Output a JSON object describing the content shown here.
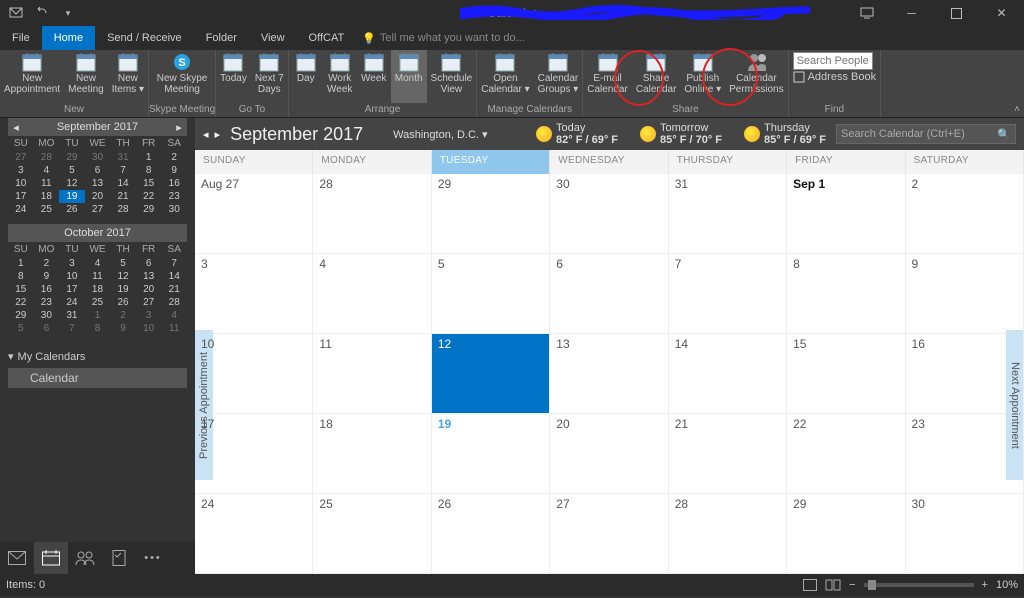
{
  "title_bar": {
    "app_title": "Calendar"
  },
  "ribbon": {
    "tabs": [
      "File",
      "Home",
      "Send / Receive",
      "Folder",
      "View",
      "OffCAT"
    ],
    "active_tab": "Home",
    "tellme": "Tell me what you want to do...",
    "groups": {
      "new": {
        "label": "New",
        "buttons": [
          {
            "l": "New\nAppointment"
          },
          {
            "l": "New\nMeeting"
          },
          {
            "l": "New\nItems ▾"
          }
        ]
      },
      "skype": {
        "label": "Skype Meeting",
        "buttons": [
          {
            "l": "New Skype\nMeeting"
          }
        ]
      },
      "goto": {
        "label": "Go To",
        "buttons": [
          {
            "l": "Today"
          },
          {
            "l": "Next 7\nDays"
          }
        ]
      },
      "arrange": {
        "label": "Arrange",
        "buttons": [
          {
            "l": "Day"
          },
          {
            "l": "Work\nWeek"
          },
          {
            "l": "Week"
          },
          {
            "l": "Month"
          },
          {
            "l": "Schedule\nView"
          }
        ],
        "selected": 3
      },
      "manage": {
        "label": "Manage Calendars",
        "buttons": [
          {
            "l": "Open\nCalendar ▾"
          },
          {
            "l": "Calendar\nGroups ▾"
          }
        ]
      },
      "share": {
        "label": "Share",
        "buttons": [
          {
            "l": "E-mail\nCalendar"
          },
          {
            "l": "Share\nCalendar"
          },
          {
            "l": "Publish\nOnline ▾"
          },
          {
            "l": "Calendar\nPermissions"
          }
        ]
      },
      "find": {
        "label": "Find",
        "search_placeholder": "Search People",
        "addr": "Address Book"
      }
    }
  },
  "sidebar": {
    "cal1": {
      "title": "September 2017",
      "dow": [
        "SU",
        "MO",
        "TU",
        "WE",
        "TH",
        "FR",
        "SA"
      ],
      "days": [
        {
          "n": 27,
          "dim": 1
        },
        {
          "n": 28,
          "dim": 1
        },
        {
          "n": 29,
          "dim": 1
        },
        {
          "n": 30,
          "dim": 1
        },
        {
          "n": 31,
          "dim": 1
        },
        {
          "n": 1
        },
        {
          "n": 2
        },
        {
          "n": 3
        },
        {
          "n": 4
        },
        {
          "n": 5
        },
        {
          "n": 6
        },
        {
          "n": 7
        },
        {
          "n": 8
        },
        {
          "n": 9
        },
        {
          "n": 10
        },
        {
          "n": 11
        },
        {
          "n": 12
        },
        {
          "n": 13
        },
        {
          "n": 14
        },
        {
          "n": 15
        },
        {
          "n": 16
        },
        {
          "n": 17
        },
        {
          "n": 18
        },
        {
          "n": 19,
          "today": 1
        },
        {
          "n": 20
        },
        {
          "n": 21
        },
        {
          "n": 22
        },
        {
          "n": 23
        },
        {
          "n": 24
        },
        {
          "n": 25
        },
        {
          "n": 26
        },
        {
          "n": 27
        },
        {
          "n": 28
        },
        {
          "n": 29
        },
        {
          "n": 30
        }
      ]
    },
    "cal2": {
      "title": "October 2017",
      "dow": [
        "SU",
        "MO",
        "TU",
        "WE",
        "TH",
        "FR",
        "SA"
      ],
      "days": [
        {
          "n": 1
        },
        {
          "n": 2
        },
        {
          "n": 3
        },
        {
          "n": 4
        },
        {
          "n": 5
        },
        {
          "n": 6
        },
        {
          "n": 7
        },
        {
          "n": 8
        },
        {
          "n": 9
        },
        {
          "n": 10
        },
        {
          "n": 11
        },
        {
          "n": 12
        },
        {
          "n": 13
        },
        {
          "n": 14
        },
        {
          "n": 15
        },
        {
          "n": 16
        },
        {
          "n": 17
        },
        {
          "n": 18
        },
        {
          "n": 19
        },
        {
          "n": 20
        },
        {
          "n": 21
        },
        {
          "n": 22
        },
        {
          "n": 23
        },
        {
          "n": 24
        },
        {
          "n": 25
        },
        {
          "n": 26
        },
        {
          "n": 27
        },
        {
          "n": 28
        },
        {
          "n": 29
        },
        {
          "n": 30
        },
        {
          "n": 31
        },
        {
          "n": 1,
          "dim": 1
        },
        {
          "n": 2,
          "dim": 1
        },
        {
          "n": 3,
          "dim": 1
        },
        {
          "n": 4,
          "dim": 1
        },
        {
          "n": 5,
          "dim": 1
        },
        {
          "n": 6,
          "dim": 1
        },
        {
          "n": 7,
          "dim": 1
        },
        {
          "n": 8,
          "dim": 1
        },
        {
          "n": 9,
          "dim": 1
        },
        {
          "n": 10,
          "dim": 1
        },
        {
          "n": 11,
          "dim": 1
        }
      ]
    },
    "tree": {
      "header": "My Calendars",
      "item": "Calendar"
    }
  },
  "calendar": {
    "month_title": "September 2017",
    "location": "Washington,  D.C. ▾",
    "weather": [
      {
        "label": "Today",
        "temp": "82° F / 69° F"
      },
      {
        "label": "Tomorrow",
        "temp": "85° F / 70° F"
      },
      {
        "label": "Thursday",
        "temp": "85° F / 69° F"
      }
    ],
    "search_placeholder": "Search Calendar (Ctrl+E)",
    "day_headers": [
      "SUNDAY",
      "MONDAY",
      "TUESDAY",
      "WEDNESDAY",
      "THURSDAY",
      "FRIDAY",
      "SATURDAY"
    ],
    "rows": [
      [
        {
          "d": "Aug 27"
        },
        {
          "d": "28"
        },
        {
          "d": "29"
        },
        {
          "d": "30"
        },
        {
          "d": "31"
        },
        {
          "d": "Sep 1",
          "bold": 1
        },
        {
          "d": "2"
        }
      ],
      [
        {
          "d": "3"
        },
        {
          "d": "4"
        },
        {
          "d": "5"
        },
        {
          "d": "6"
        },
        {
          "d": "7"
        },
        {
          "d": "8"
        },
        {
          "d": "9"
        }
      ],
      [
        {
          "d": "10"
        },
        {
          "d": "11"
        },
        {
          "d": "12",
          "sel": 1
        },
        {
          "d": "13"
        },
        {
          "d": "14"
        },
        {
          "d": "15"
        },
        {
          "d": "16"
        }
      ],
      [
        {
          "d": "17"
        },
        {
          "d": "18"
        },
        {
          "d": "19",
          "today": 1
        },
        {
          "d": "20"
        },
        {
          "d": "21"
        },
        {
          "d": "22"
        },
        {
          "d": "23"
        }
      ],
      [
        {
          "d": "24"
        },
        {
          "d": "25"
        },
        {
          "d": "26"
        },
        {
          "d": "27"
        },
        {
          "d": "28"
        },
        {
          "d": "29"
        },
        {
          "d": "30"
        }
      ]
    ],
    "prev_tab": "Previous Appointment",
    "next_tab": "Next Appointment"
  },
  "status": {
    "items": "Items: 0",
    "zoom": "10%"
  }
}
